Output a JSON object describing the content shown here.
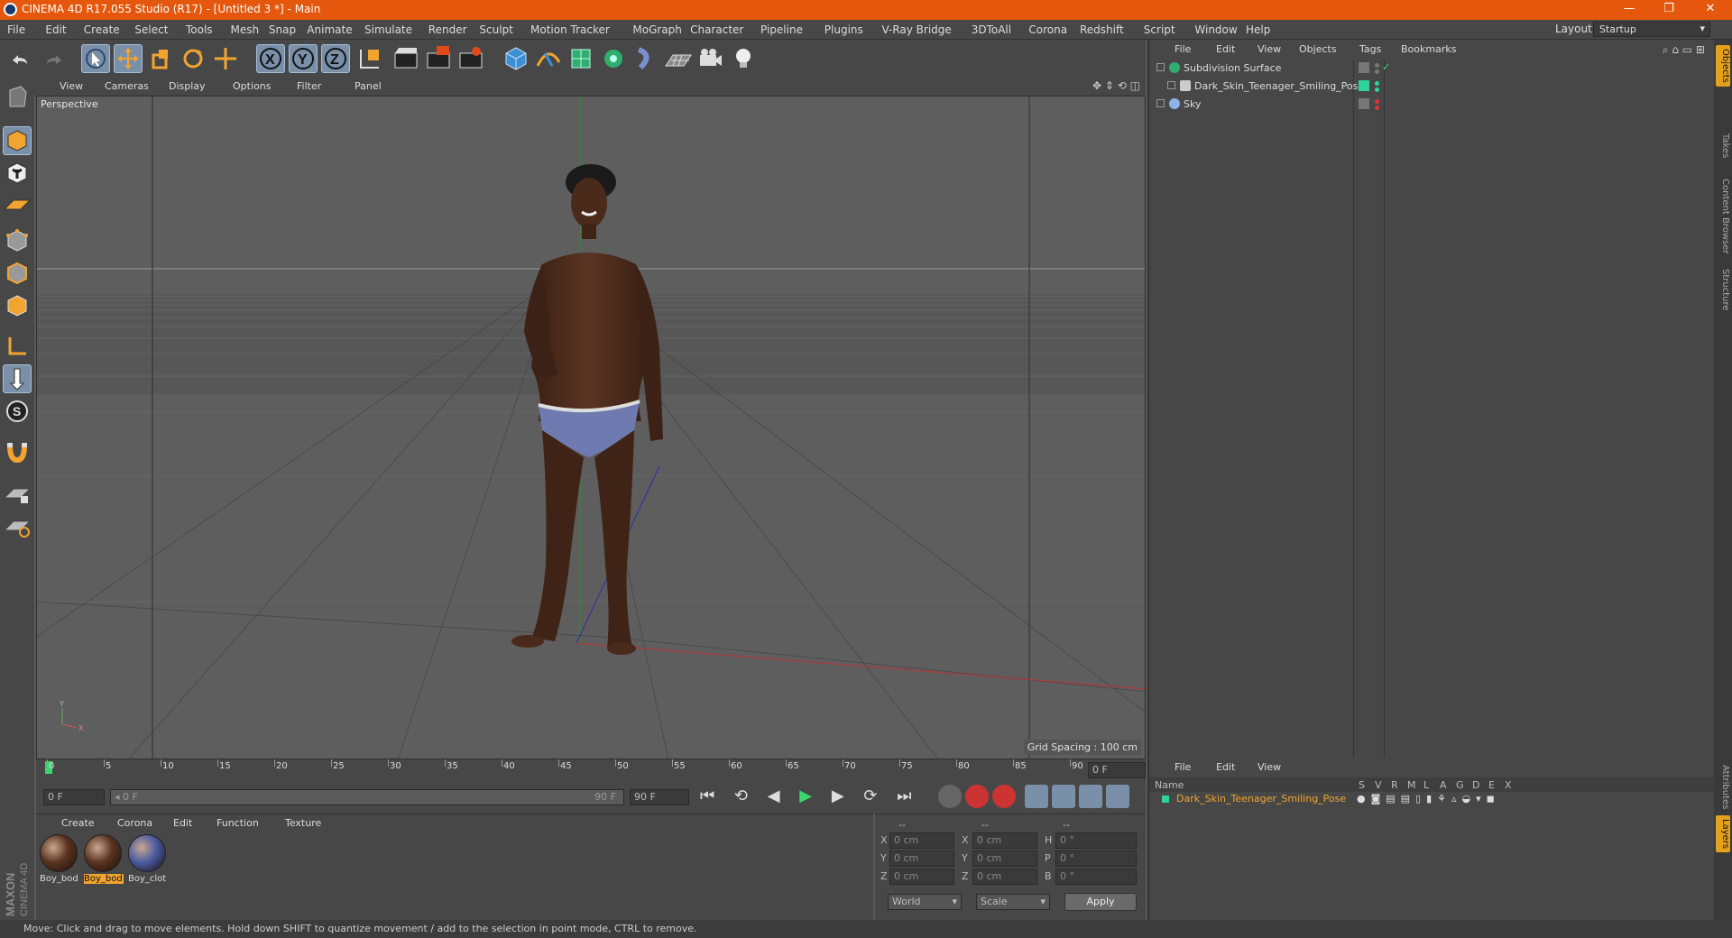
{
  "window": {
    "title": "CINEMA 4D R17.055 Studio (R17) - [Untitled 3 *] - Main",
    "minimize": "—",
    "maximize": "❐",
    "close": "✕"
  },
  "menu": [
    "File",
    "Edit",
    "Create",
    "Select",
    "Tools",
    "Mesh",
    "Snap",
    "Animate",
    "Simulate",
    "Render",
    "Sculpt",
    "Motion Tracker",
    "MoGraph",
    "Character",
    "Pipeline",
    "Plugins",
    "V-Ray Bridge",
    "3DToAll",
    "Corona",
    "Redshift",
    "Script",
    "Window",
    "Help"
  ],
  "layout": {
    "label": "Layout:",
    "value": "Startup"
  },
  "viewport": {
    "menu": [
      "View",
      "Cameras",
      "Display",
      "Options",
      "Filter",
      "Panel"
    ],
    "camera": "Perspective",
    "grid_spacing": "Grid Spacing : 100 cm"
  },
  "timeline": {
    "ticks": [
      "0",
      "5",
      "10",
      "15",
      "20",
      "25",
      "30",
      "35",
      "40",
      "45",
      "50",
      "55",
      "60",
      "65",
      "70",
      "75",
      "80",
      "85",
      "90"
    ],
    "current": "0 F"
  },
  "transport": {
    "start": "0 F",
    "range_start": "0 F",
    "range_end": "90 F",
    "end": "90 F"
  },
  "materials": {
    "menu": [
      "Create",
      "Corona",
      "Edit",
      "Function",
      "Texture"
    ],
    "items": [
      {
        "name": "Boy_bod",
        "color": "#5a3320",
        "selected": false
      },
      {
        "name": "Boy_bod",
        "color": "#5a3320",
        "selected": true
      },
      {
        "name": "Boy_clot",
        "color": "#4a5aa0",
        "selected": false
      }
    ]
  },
  "coords": {
    "headers": [
      "--",
      "--",
      "--"
    ],
    "rows": [
      {
        "a": "X",
        "av": "0 cm",
        "b": "X",
        "bv": "0 cm",
        "c": "H",
        "cv": "0 °"
      },
      {
        "a": "Y",
        "av": "0 cm",
        "b": "Y",
        "bv": "0 cm",
        "c": "P",
        "cv": "0 °"
      },
      {
        "a": "Z",
        "av": "0 cm",
        "b": "Z",
        "bv": "0 cm",
        "c": "B",
        "cv": "0 °"
      }
    ],
    "mode": "World",
    "scale": "Scale",
    "apply": "Apply"
  },
  "objects": {
    "menu": [
      "File",
      "Edit",
      "View",
      "Objects",
      "Tags",
      "Bookmarks"
    ],
    "items": [
      {
        "name": "Subdivision Surface",
        "indent": 0
      },
      {
        "name": "Dark_Skin_Teenager_Smiling_Pose",
        "indent": 1
      },
      {
        "name": "Sky",
        "indent": 0
      }
    ]
  },
  "layers": {
    "menu": [
      "File",
      "Edit",
      "View"
    ],
    "name_header": "Name",
    "cols": [
      "S",
      "V",
      "R",
      "M",
      "L",
      "A",
      "G",
      "D",
      "E",
      "X"
    ],
    "item": "Dark_Skin_Teenager_Smiling_Pose"
  },
  "right_tabs": [
    "Objects",
    "Takes",
    "Content Browser",
    "Structure",
    "Attributes",
    "Layers"
  ],
  "status": "Move: Click and drag to move elements. Hold down SHIFT to quantize movement / add to the selection in point mode, CTRL to remove.",
  "brand": {
    "maxon": "MAXON",
    "cinema": "CINEMA 4D"
  }
}
